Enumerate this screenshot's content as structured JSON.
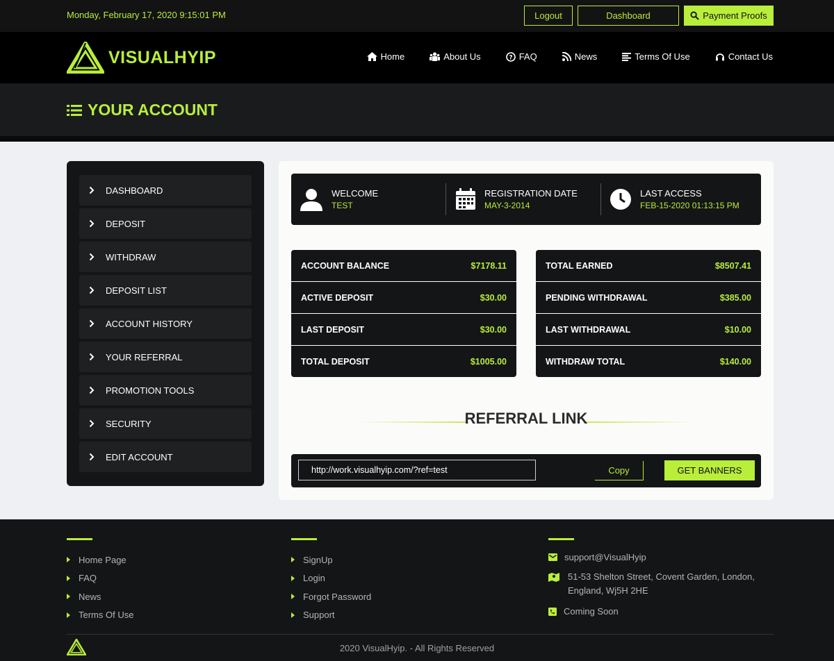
{
  "topbar": {
    "datetime": "Monday, February 17, 2020 9:15:01 PM",
    "logout": "Logout",
    "dashboard": "Dashboard",
    "payment_proofs": "Payment Proofs"
  },
  "header": {
    "logo_text": "VISUALHYIP",
    "nav": [
      "Home",
      "About Us",
      "FAQ",
      "News",
      "Terms Of Use",
      "Contact Us"
    ]
  },
  "page_title": "YOUR ACCOUNT",
  "sidebar": {
    "items": [
      "DASHBOARD",
      "DEPOSIT",
      "WITHDRAW",
      "DEPOSIT LIST",
      "ACCOUNT HISTORY",
      "YOUR REFERRAL",
      "PROMOTION TOOLS",
      "SECURITY",
      "EDIT ACCOUNT"
    ]
  },
  "info": {
    "welcome_label": "WELCOME",
    "welcome_value": "TEST",
    "reg_label": "REGISTRATION DATE",
    "reg_value": "MAY-3-2014",
    "access_label": "LAST ACCESS",
    "access_value": "FEB-15-2020 01:13:15 PM"
  },
  "stats_left": [
    {
      "label": "ACCOUNT BALANCE",
      "value": "$7178.11"
    },
    {
      "label": "ACTIVE DEPOSIT",
      "value": "$30.00"
    },
    {
      "label": "LAST DEPOSIT",
      "value": "$30.00"
    },
    {
      "label": "TOTAL DEPOSIT",
      "value": "$1005.00"
    }
  ],
  "stats_right": [
    {
      "label": "TOTAL EARNED",
      "value": "$8507.41"
    },
    {
      "label": "PENDING WITHDRAWAL",
      "value": "$385.00"
    },
    {
      "label": "LAST WITHDRAWAL",
      "value": "$10.00"
    },
    {
      "label": "WITHDRAW TOTAL",
      "value": "$140.00"
    }
  ],
  "referral": {
    "title": "REFERRAL LINK",
    "link": "http://work.visualhyip.com/?ref=test",
    "copy": "Copy",
    "banners": "GET BANNERS"
  },
  "footer": {
    "col1": [
      "Home Page",
      "FAQ",
      "News",
      "Terms Of Use"
    ],
    "col2": [
      "SignUp",
      "Login",
      "Forgot Password",
      "Support"
    ],
    "email": "support@VisualHyip",
    "address": "51-53 Shelton Street, Covent Garden, London, England, Wj5H 2HE",
    "phone": "Coming Soon",
    "copyright": "2020 VisualHyip. - All Rights Reserved"
  },
  "colors": {
    "accent": "#b9ee3a",
    "dark": "#141516"
  }
}
